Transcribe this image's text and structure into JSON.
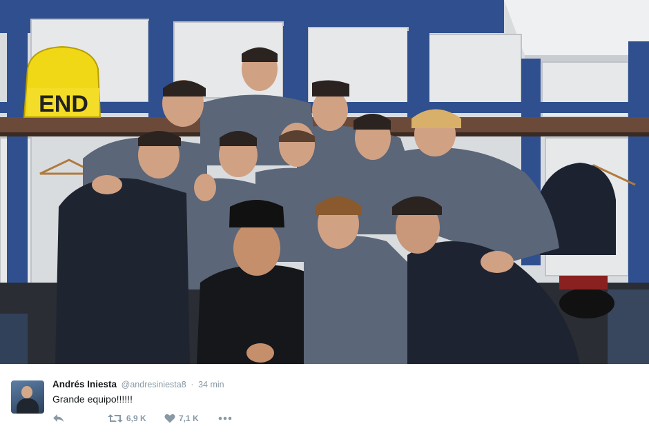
{
  "tweet": {
    "display_name": "Andrés Iniesta",
    "handle": "@andresiniesta8",
    "separator": "·",
    "time": "34 min",
    "text": "Grande equipo!!!!!!",
    "actions": {
      "reply_icon": "reply-icon",
      "retweet_icon": "retweet-icon",
      "retweet_count": "6,9 K",
      "like_icon": "heart-icon",
      "like_count": "7,1 K",
      "more_icon": "more-icon"
    }
  },
  "photo": {
    "description_icon": "team-photo",
    "bag_text": "END"
  },
  "colors": {
    "name": "#14171a",
    "meta": "#8899a6",
    "wall_trim": "#2f4f8f",
    "shirt": "#5b6678"
  }
}
